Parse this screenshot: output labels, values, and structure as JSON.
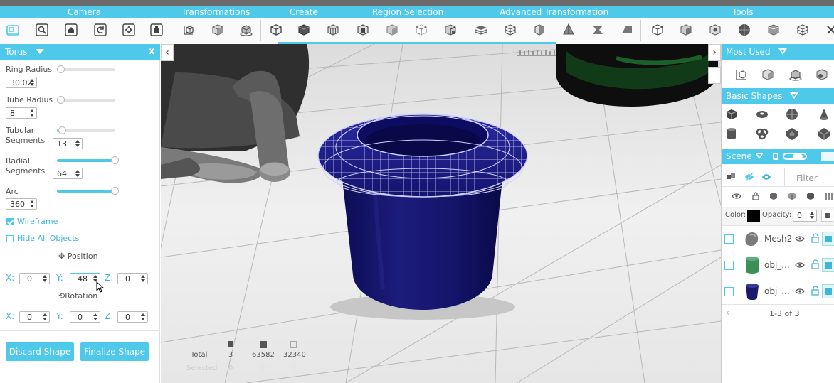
{
  "menu": {
    "categories": [
      "Camera",
      "Transformations",
      "Create",
      "Region Selection",
      "Advanced Transformation",
      "Tools"
    ]
  },
  "toolbar": {
    "groups": [
      [
        "crop-icon",
        "zoom-icon",
        "home-camera-icon",
        "rotate-camera-icon",
        "camera-settings-icon",
        "screenshot-icon"
      ],
      [
        "scale-box-icon",
        "cube-move-icon",
        "cube-rotate-icon"
      ],
      [
        "create-box-icon",
        "create-dark-box-icon",
        "create-grid-box-icon"
      ],
      [
        "region-box-icon",
        "region-solid-icon",
        "region-wire-icon",
        "region-split-icon"
      ],
      [
        "adv-layers-icon",
        "adv-grid-icon",
        "adv-half-icon",
        "adv-cone-icon",
        "adv-twist-icon",
        "adv-bevel-icon"
      ],
      [
        "tool-cube-icon",
        "tool-solid-icon",
        "tool-split-icon",
        "tool-sphere-icon",
        "tool-box-icon",
        "tool-grid-icon",
        "tool-link-icon"
      ]
    ]
  },
  "colors": {
    "accent": "#4ec9ea",
    "accent_text": "#3fb6d8"
  },
  "left_panel": {
    "title": "Torus",
    "close_label": "x",
    "ring_radius": {
      "label": "Ring Radius",
      "value": "30.02",
      "level": 0.05
    },
    "tube_radius": {
      "label": "Tube Radius",
      "value": "8",
      "level": 0.0
    },
    "tubular_segments": {
      "label_line1": "Tubular",
      "label_line2": "Segments",
      "value": "13",
      "level": 0.1
    },
    "radial_segments": {
      "label_line1": "Radial",
      "label_line2": "Segments",
      "value": "64",
      "level": 1.0
    },
    "arc": {
      "label": "Arc",
      "value": "360",
      "level": 1.0
    },
    "wireframe": {
      "label": "Wireframe",
      "checked": true
    },
    "hide_all": {
      "label": "Hide All Objects",
      "checked": false
    },
    "position": {
      "label": "Position",
      "x_label": "X:",
      "x": "0",
      "y_label": "Y:",
      "y": "48",
      "z_label": "Z:",
      "z": "0"
    },
    "rotation": {
      "label": "Rotation",
      "x_label": "X:",
      "x": "0",
      "y_label": "Y:",
      "y": "0",
      "z_label": "Z:",
      "z": "0"
    },
    "discard_label": "Discard Shape",
    "finalize_label": "Finalize Shape"
  },
  "viewport": {
    "left_toggle": "‹",
    "right_toggle": "›",
    "stats": {
      "total_label": "Total",
      "selected_label": "Selected",
      "objects_total": "3",
      "vertices_total": "63582",
      "faces_total": "32340",
      "objects_selected": "0",
      "vertices_selected": "0",
      "faces_selected": "0"
    }
  },
  "right_panel": {
    "most_used_title": "Most Used",
    "basic_shapes_title": "Basic Shapes",
    "scene_title": "Scene",
    "filter_placeholder": "Filter",
    "color_label": "Color:",
    "opacity_label": "Opacity:",
    "opacity_value": "0",
    "objects": [
      {
        "name": "Mesh2",
        "color": "#7a7a7a"
      },
      {
        "name": "obj_...",
        "color": "#3d8f58"
      },
      {
        "name": "obj_...",
        "color": "#1b1b6b"
      }
    ],
    "pagination": "1-3 of 3"
  }
}
